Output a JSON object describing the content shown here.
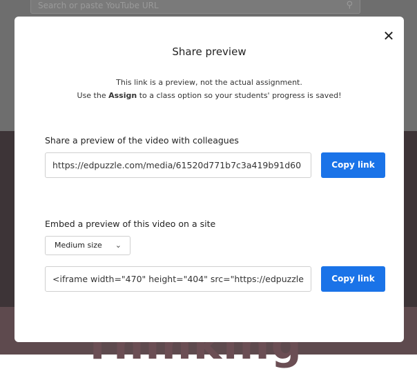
{
  "background": {
    "search_placeholder": "Search or paste YouTube URL",
    "large_text": "Thinking"
  },
  "modal": {
    "title": "Share preview",
    "description_line1": "This link is a preview, not the actual assignment.",
    "description_line2_prefix": "Use the ",
    "description_line2_bold": "Assign",
    "description_line2_suffix": " to a class option so your students' progress is saved!",
    "share": {
      "label": "Share a preview of the video with colleagues",
      "url": "https://edpuzzle.com/media/61520d771b7c3a419b91d60",
      "copy_label": "Copy link"
    },
    "embed": {
      "label": "Embed a preview of this video on a site",
      "size_selected": "Medium size",
      "code": "<iframe width=\"470\" height=\"404\" src=\"https://edpuzzle",
      "copy_label": "Copy link"
    }
  },
  "colors": {
    "accent": "#1a73e8",
    "overlay": "#5a5a5a"
  }
}
